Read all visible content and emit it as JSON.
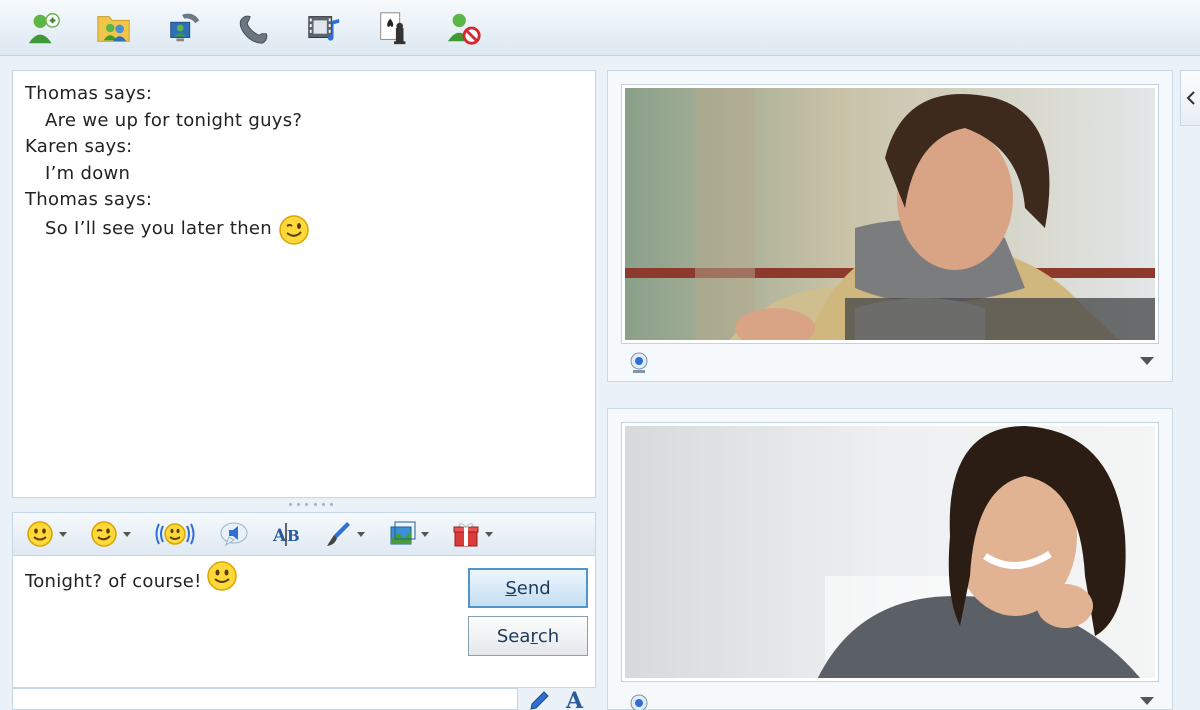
{
  "toolbar": {
    "buttons": [
      {
        "name": "add-contact",
        "icon": "add-contact-icon"
      },
      {
        "name": "share-folder",
        "icon": "shared-folder-icon"
      },
      {
        "name": "video-call",
        "icon": "video-call-icon"
      },
      {
        "name": "call",
        "icon": "phone-icon"
      },
      {
        "name": "share-media",
        "icon": "media-icon"
      },
      {
        "name": "games",
        "icon": "games-icon"
      },
      {
        "name": "block-contact",
        "icon": "block-contact-icon"
      }
    ]
  },
  "conversation": {
    "messages": [
      {
        "sender": "Thomas says:",
        "text": "Are we up for tonight guys?",
        "emoticon": null
      },
      {
        "sender": "Karen says:",
        "text": "I’m down",
        "emoticon": null
      },
      {
        "sender": "Thomas says:",
        "text": "So I’ll see you later then",
        "emoticon": "wink-emoticon"
      }
    ]
  },
  "format_bar": {
    "buttons": [
      "emoticon-icon",
      "wink-icon",
      "nudge-icon",
      "voice-clip-icon",
      "font-icon",
      "paint-icon",
      "background-icon",
      "gift-icon"
    ]
  },
  "compose": {
    "text": "Tonight? of course!",
    "emoticon": "smile-emoticon",
    "send_prefix": "",
    "send_hotkey": "S",
    "send_suffix": "end",
    "search_prefix": "Sea",
    "search_hotkey": "r",
    "search_suffix": "ch"
  },
  "colors": {
    "accent": "#4f95cc",
    "panel_border": "#c5d6e4",
    "background": "#eaf2f8"
  }
}
